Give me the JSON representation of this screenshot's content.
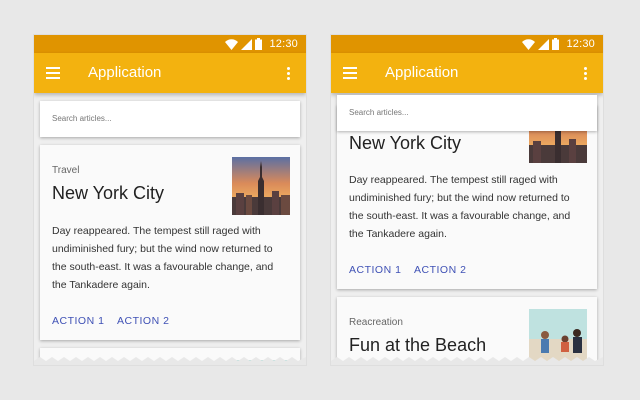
{
  "status": {
    "time": "12:30"
  },
  "app": {
    "title": "Application"
  },
  "search": {
    "placeholder": "Search articles..."
  },
  "articles": [
    {
      "category": "Travel",
      "title": "New York City",
      "body": "Day reappeared. The tempest still raged with undiminished fury; but the wind now returned to the south-east. It was a favourable change, and the Tankadere again.",
      "action1": "ACTION 1",
      "action2": "ACTION 2"
    },
    {
      "category": "Reacreation",
      "title": "Fun at the Beach"
    }
  ],
  "colors": {
    "statusbar": "#e09400",
    "appbar": "#f3b20f",
    "action": "#3f51b5"
  }
}
